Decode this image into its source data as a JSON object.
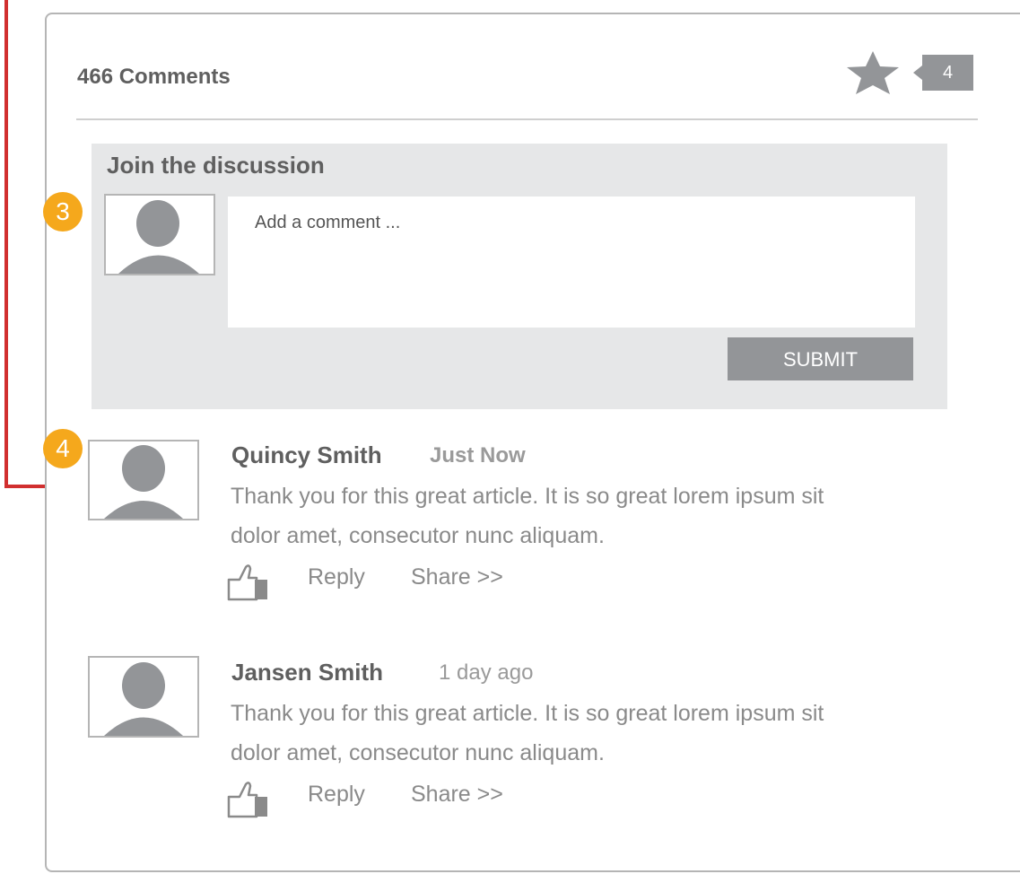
{
  "header": {
    "comments_count": "466 Comments",
    "favorite_count": "4"
  },
  "compose": {
    "title": "Join the discussion",
    "placeholder": "Add a comment ...",
    "submit_label": "SUBMIT"
  },
  "annotations": {
    "marker_compose": "3",
    "marker_comment": "4"
  },
  "comments": [
    {
      "author": "Quincy Smith",
      "time": "Just Now",
      "text_line1": "Thank you for this great article. It is so great lorem ipsum sit",
      "text_line2": "dolor amet, consecutor nunc aliquam.",
      "reply_label": "Reply",
      "share_label": "Share >>"
    },
    {
      "author": "Jansen Smith",
      "time": "1 day ago",
      "text_line1": "Thank you for this great article. It is so great lorem ipsum sit",
      "text_line2": "dolor amet, consecutor nunc aliquam.",
      "reply_label": "Reply",
      "share_label": "Share >>"
    }
  ],
  "icons": {
    "star": "star-icon",
    "avatar": "user-silhouette-icon",
    "like": "thumbs-up-icon"
  },
  "colors": {
    "accent_gray": "#939598",
    "marker_orange": "#f5a81c",
    "arrow_red": "#d12f2f"
  }
}
